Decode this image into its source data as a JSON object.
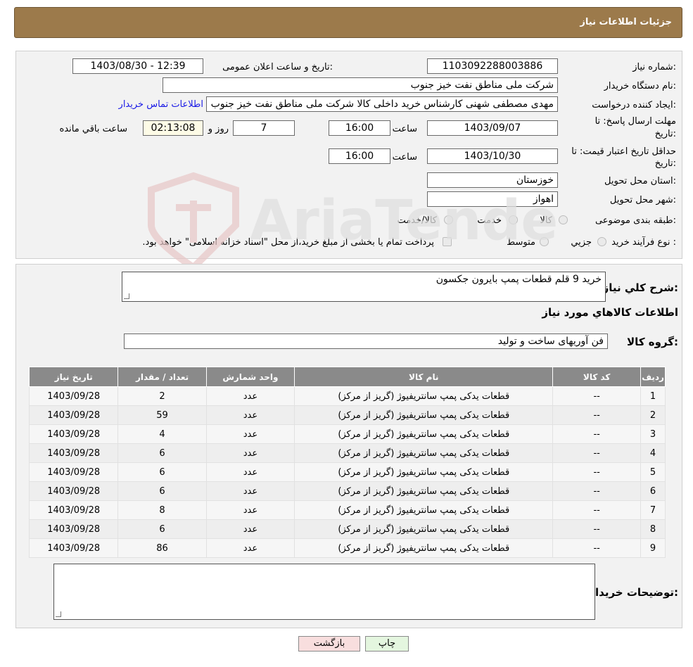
{
  "header": {
    "title": "جزئیات اطلاعات نیاز"
  },
  "form": {
    "need_number_label": "شماره نیاز:",
    "need_number": "1103092288003886",
    "announce_label": "تاریخ و ساعت اعلان عمومی:",
    "announce_value": "1403/08/30 - 12:39",
    "buyer_org_label": "نام دستگاه خریدار:",
    "buyer_org": "شرکت ملی مناطق نفت خیز جنوب",
    "creator_label": "ایجاد کننده درخواست:",
    "creator": "مهدی  مصطفی شهنی کارشناس خرید داخلی کالا  شرکت ملی مناطق نفت خیز جنوب",
    "contact_link": "اطلاعات تماس خریدار",
    "deadline_label_1": "مهلت ارسال پاسخ: تا",
    "deadline_label_2": "تاریخ:",
    "deadline_date": "1403/09/07",
    "time_label": "ساعت",
    "deadline_time": "16:00",
    "days_value": "7",
    "days_label": "روز و",
    "remaining_value": "02:13:08",
    "remaining_label": "ساعت باقي مانده",
    "validity_label_1": "حداقل تاریخ اعتبار قیمت: تا",
    "validity_label_2": "تاریخ:",
    "validity_date": "1403/10/30",
    "validity_time": "16:00",
    "province_label": "استان محل تحویل:",
    "province": "خوزستان",
    "city_label": "شهر محل تحویل:",
    "city": "اهواز",
    "category_label": "طبقه بندی موضوعی:",
    "category_options": [
      "کالا",
      "خدمت",
      "کالا/خدمت"
    ],
    "process_label": "نوع فرآیند خرید :",
    "process_options": [
      "جزيي",
      "متوسط"
    ],
    "process_note": "پرداخت تمام یا بخشی از مبلغ خرید،از محل \"اسناد خزانه اسلامی\" خواهد بود."
  },
  "details": {
    "summary_label": "شرح كلي نياز:",
    "summary_value": "خرید 9 قلم قطعات پمپ بایرون جکسون",
    "goods_info_title": "اطلاعات کالاهاي مورد نياز",
    "goods_group_label": "گروه کالا:",
    "goods_group_value": "فن آوریهای ساخت و تولید",
    "table": {
      "headers": [
        "رديف",
        "کد کالا",
        "نام کالا",
        "واحد شمارش",
        "تعداد / مقدار",
        "تاریخ نیاز"
      ],
      "rows": [
        [
          "1",
          "--",
          "قطعات یدکی پمپ سانتریفیوژ (گریز از مرکز)",
          "عدد",
          "2",
          "1403/09/28"
        ],
        [
          "2",
          "--",
          "قطعات یدکی پمپ سانتریفیوژ (گریز از مرکز)",
          "عدد",
          "59",
          "1403/09/28"
        ],
        [
          "3",
          "--",
          "قطعات یدکی پمپ سانتریفیوژ (گریز از مرکز)",
          "عدد",
          "4",
          "1403/09/28"
        ],
        [
          "4",
          "--",
          "قطعات یدکی پمپ سانتریفیوژ (گریز از مرکز)",
          "عدد",
          "6",
          "1403/09/28"
        ],
        [
          "5",
          "--",
          "قطعات یدکی پمپ سانتریفیوژ (گریز از مرکز)",
          "عدد",
          "6",
          "1403/09/28"
        ],
        [
          "6",
          "--",
          "قطعات یدکی پمپ سانتریفیوژ (گریز از مرکز)",
          "عدد",
          "6",
          "1403/09/28"
        ],
        [
          "7",
          "--",
          "قطعات یدکی پمپ سانتریفیوژ (گریز از مرکز)",
          "عدد",
          "8",
          "1403/09/28"
        ],
        [
          "8",
          "--",
          "قطعات یدکی پمپ سانتریفیوژ (گریز از مرکز)",
          "عدد",
          "6",
          "1403/09/28"
        ],
        [
          "9",
          "--",
          "قطعات یدکی پمپ سانتریفیوژ (گریز از مرکز)",
          "عدد",
          "86",
          "1403/09/28"
        ]
      ]
    },
    "buyer_notes_label": "توضیحات خریدار:",
    "buyer_notes_value": ""
  },
  "buttons": {
    "print": "چاپ",
    "back": "بازگشت"
  },
  "watermark": {
    "text": "AriaTender.neT"
  },
  "colors": {
    "header_bg": "#9c7a4b",
    "table_header_bg": "#8a8a8a",
    "link": "#1a1ae6",
    "back_button_bg": "#f8dede",
    "print_button_bg": "#e4f6df"
  }
}
